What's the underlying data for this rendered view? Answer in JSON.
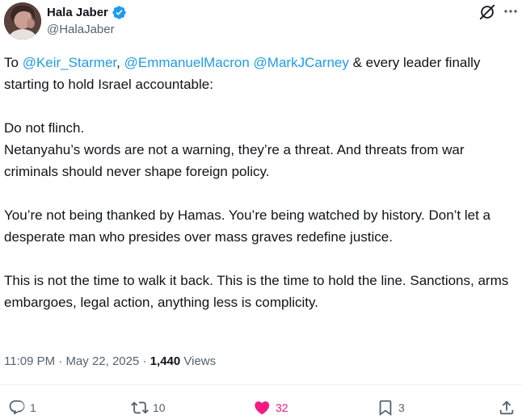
{
  "author": {
    "display_name": "Hala Jaber",
    "handle": "@HalaJaber",
    "verified": true
  },
  "tweet": {
    "line1_prefix": "To ",
    "mention1": "@Keir_Starmer",
    "comma": ", ",
    "mention2": "@EmmanuelMacron",
    "space": " ",
    "mention3": "@MarkJCarney",
    "line1_suffix": " &  every leader finally starting to hold Israel accountable:",
    "para2_line1": "Do not flinch.",
    "para2_line2": "Netanyahu’s words are not a warning, they’re a threat. And threats from war criminals should never shape foreign policy.",
    "para3": "You’re not being thanked by Hamas. You’re being watched by history. Don’t let a desperate man who presides over mass graves redefine justice.",
    "para4": "This is not the time to walk it back. This is the time to hold the line. Sanctions, arms embargoes, legal action, anything less is complicity."
  },
  "meta": {
    "time": "11:09 PM",
    "separator": " · ",
    "date": "May 22, 2025",
    "views_count": "1,440",
    "views_label": " Views"
  },
  "actions": {
    "replies": "1",
    "reposts": "10",
    "likes": "32",
    "bookmarks": "3"
  },
  "colors": {
    "accent": "#1d9bf0",
    "like": "#f91880",
    "secondary_text": "#536471"
  },
  "icons": [
    "verified-badge-icon",
    "grok-icon",
    "more-icon",
    "reply-icon",
    "repost-icon",
    "like-icon",
    "bookmark-icon",
    "share-icon"
  ]
}
